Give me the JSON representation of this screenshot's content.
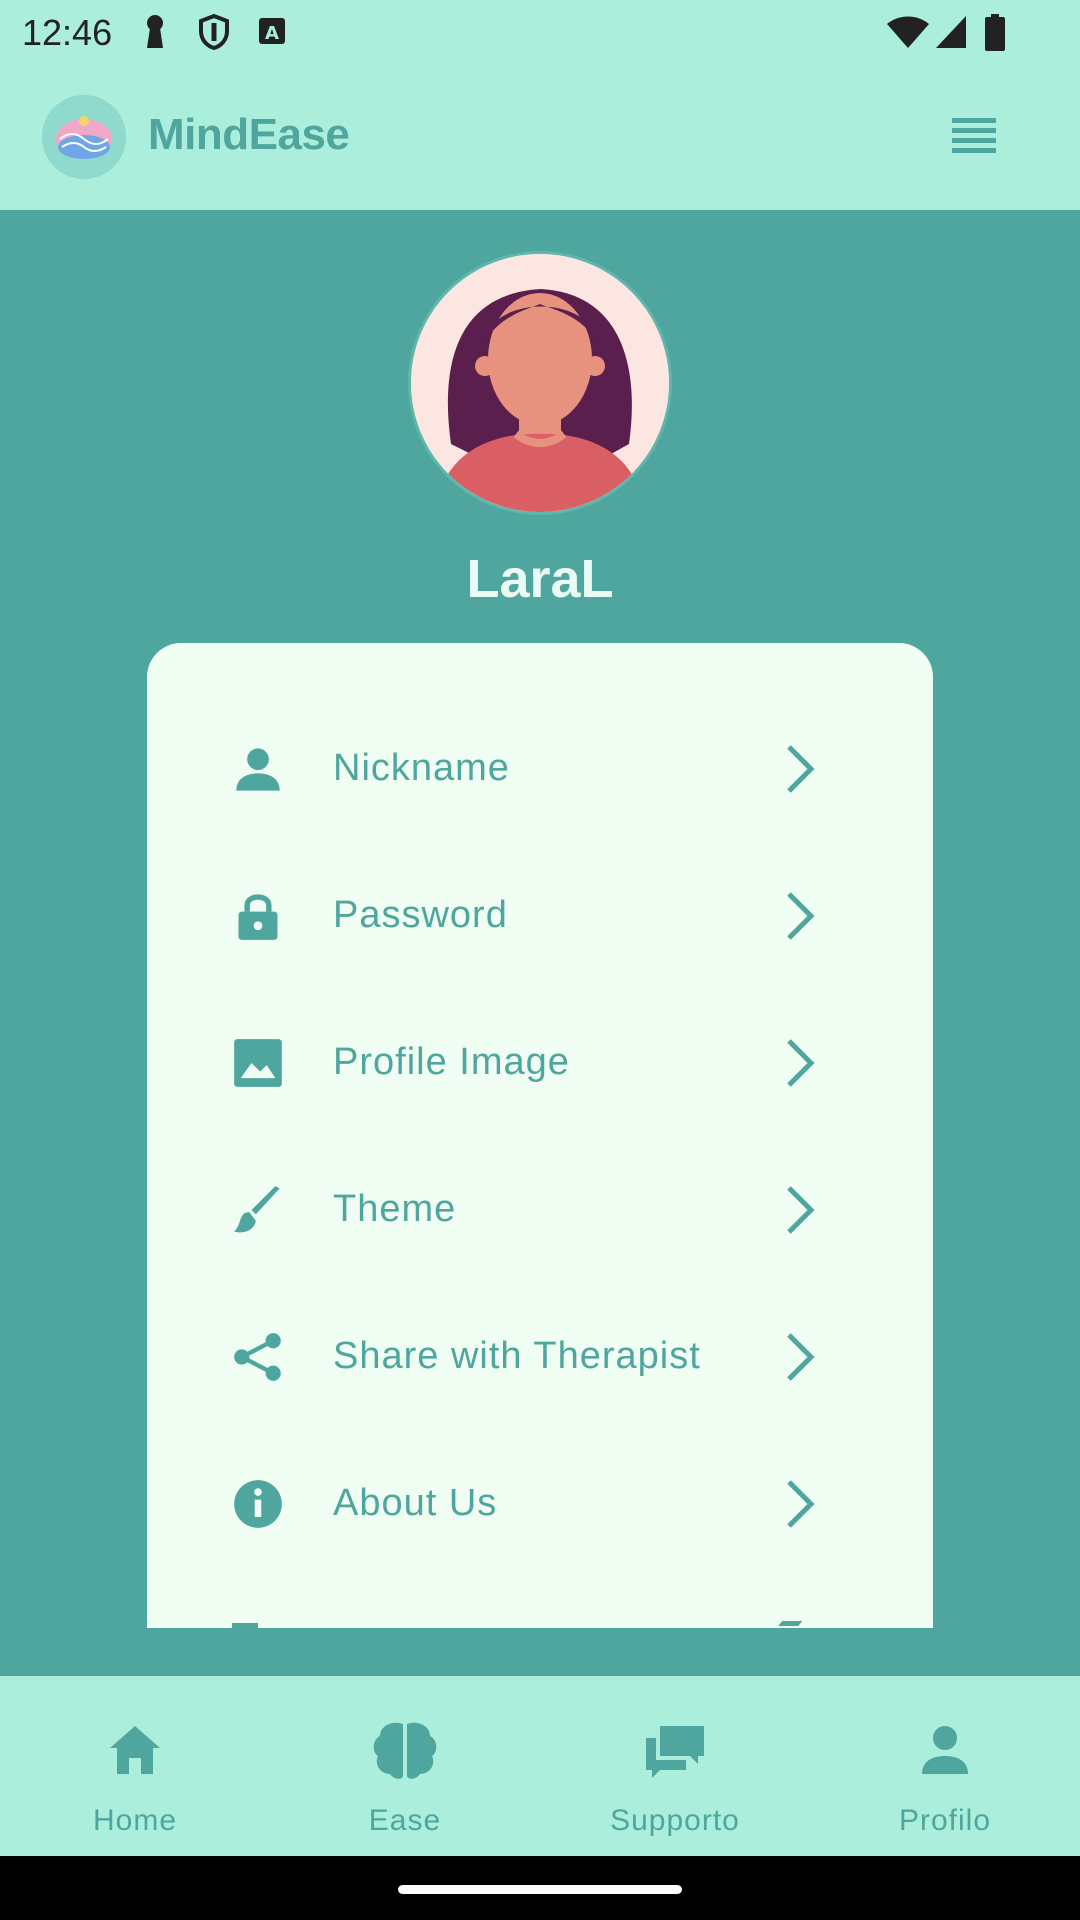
{
  "status_bar": {
    "time": "12:46",
    "icons": [
      "keyhole-icon",
      "shield-icon",
      "font-a-icon",
      "wifi-icon",
      "signal-icon",
      "battery-icon"
    ]
  },
  "app_bar": {
    "title": "MindEase",
    "logo_icon": "brain-logo-icon",
    "menu_icon": "menu-icon"
  },
  "profile": {
    "username": "LaraL"
  },
  "settings": {
    "items": [
      {
        "label": "Nickname",
        "icon": "person-icon"
      },
      {
        "label": "Password",
        "icon": "lock-icon"
      },
      {
        "label": "Profile Image",
        "icon": "image-icon"
      },
      {
        "label": "Theme",
        "icon": "brush-icon"
      },
      {
        "label": "Share with Therapist",
        "icon": "share-icon"
      },
      {
        "label": "About Us",
        "icon": "info-icon"
      }
    ]
  },
  "bottom_nav": {
    "items": [
      {
        "label": "Home",
        "icon": "home-icon"
      },
      {
        "label": "Ease",
        "icon": "brain-icon"
      },
      {
        "label": "Supporto",
        "icon": "chat-icon"
      },
      {
        "label": "Profilo",
        "icon": "person-icon"
      }
    ]
  },
  "colors": {
    "primary": "#4fa69e",
    "light_mint": "#aaeedb",
    "card": "#effdf2"
  }
}
